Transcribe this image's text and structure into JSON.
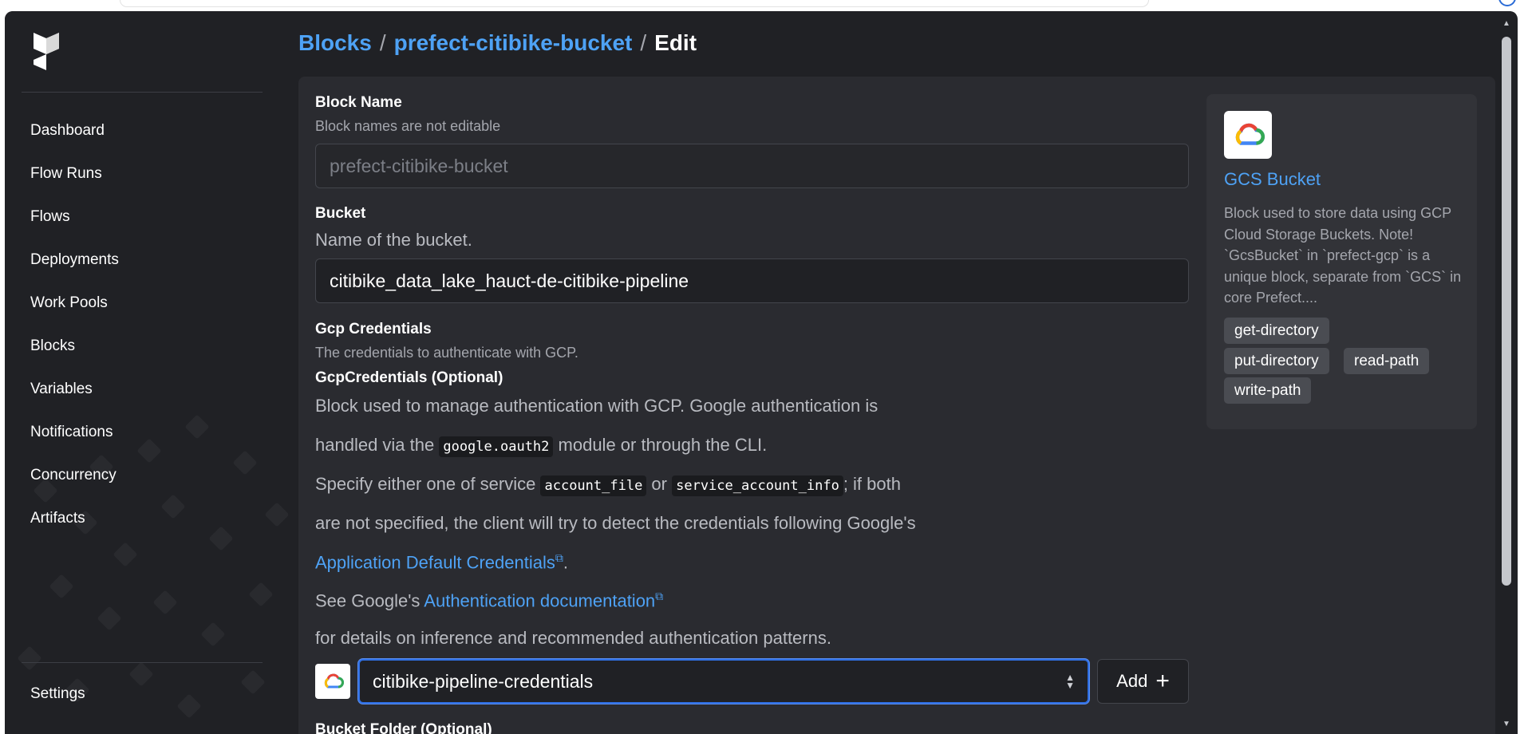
{
  "sidebar": {
    "items": [
      {
        "label": "Dashboard"
      },
      {
        "label": "Flow Runs"
      },
      {
        "label": "Flows"
      },
      {
        "label": "Deployments"
      },
      {
        "label": "Work Pools"
      },
      {
        "label": "Blocks"
      },
      {
        "label": "Variables"
      },
      {
        "label": "Notifications"
      },
      {
        "label": "Concurrency"
      },
      {
        "label": "Artifacts"
      }
    ],
    "settings_label": "Settings"
  },
  "breadcrumb": {
    "root": "Blocks",
    "sep1": "/",
    "block": "prefect-citibike-bucket",
    "sep2": "/",
    "current": "Edit"
  },
  "form": {
    "block_name": {
      "label": "Block Name",
      "description": "Block names are not editable",
      "value": "prefect-citibike-bucket"
    },
    "bucket": {
      "label": "Bucket",
      "description": "Name of the bucket.",
      "value": "citibike_data_lake_hauct-de-citibike-pipeline"
    },
    "gcp_credentials": {
      "label": "Gcp Credentials",
      "description": "The credentials to authenticate with GCP.",
      "type_label": "GcpCredentials (Optional)",
      "para1": "Block used to manage authentication with GCP. Google authentication is",
      "para2_a": "handled via the ",
      "para2_code": "google.oauth2",
      "para2_b": " module or through the CLI.",
      "para3_a": "Specify either one of service ",
      "para3_code1": "account_file",
      "para3_b": " or ",
      "para3_code2": "service_account_info",
      "para3_c": "; if both",
      "para4": "are not specified, the client will try to detect the credentials following Google's",
      "para5_link": "Application Default Credentials",
      "para5_b": ".",
      "para6_a": "See Google's ",
      "para6_link": "Authentication documentation",
      "para7": "for details on inference and recommended authentication patterns.",
      "selected": "citibike-pipeline-credentials",
      "add_label": "Add"
    },
    "bucket_folder": {
      "label": "Bucket Folder (Optional)"
    }
  },
  "info": {
    "title": "GCS Bucket",
    "description": "Block used to store data using GCP Cloud Storage Buckets. Note! `GcsBucket` in `prefect-gcp` is a unique block, separate from `GCS` in core Prefect....",
    "tags": [
      "get-directory",
      "put-directory",
      "read-path",
      "write-path"
    ]
  },
  "icons": [
    "prefect-logo-icon",
    "google-cloud-icon",
    "external-link-icon",
    "plus-icon",
    "chevron-updown-icon"
  ],
  "colors": {
    "background": "#202125",
    "card": "#2a2b30",
    "link": "#4ea2f5",
    "focus": "#2f6fe4"
  }
}
